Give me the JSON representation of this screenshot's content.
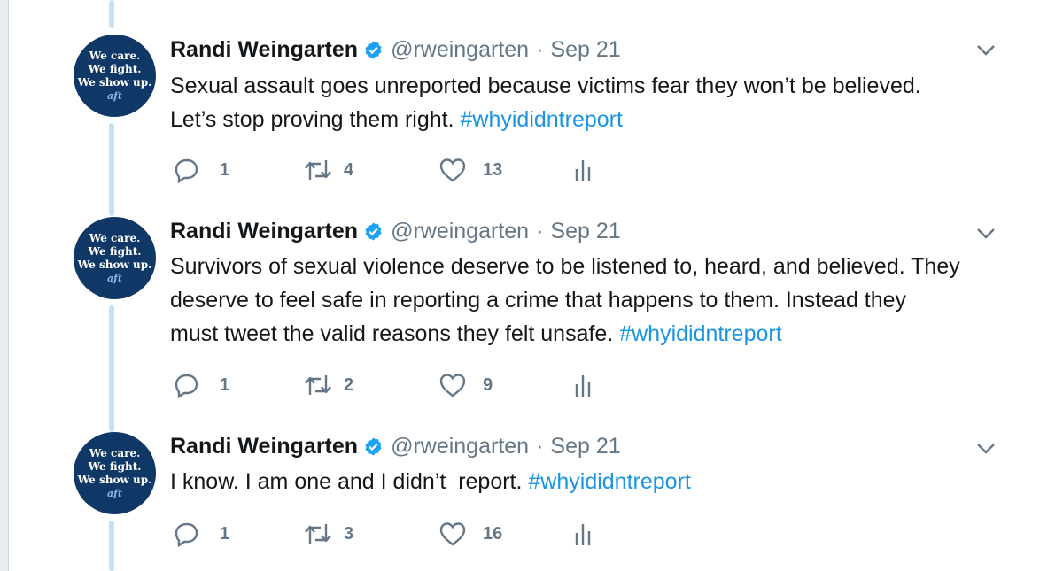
{
  "avatar": {
    "lines": [
      "We care.",
      "We fight.",
      "We show up."
    ],
    "logo": "aft"
  },
  "tweets": [
    {
      "name": "Randi Weingarten",
      "handle": "@rweingarten",
      "separator": "·",
      "date": "Sep 21",
      "text_lines": [
        "Sexual assault goes unreported because victims fear they won’t be believed.",
        "Let’s stop proving them right. "
      ],
      "hashtag": "#whyididntreport",
      "replies": "1",
      "retweets": "4",
      "likes": "13"
    },
    {
      "name": "Randi Weingarten",
      "handle": "@rweingarten",
      "separator": "·",
      "date": "Sep 21",
      "text_lines": [
        "Survivors of sexual violence deserve to be listened to, heard, and believed. They",
        "deserve to feel safe in reporting a crime that happens to them. Instead they",
        "must tweet the valid reasons they felt unsafe. "
      ],
      "hashtag": "#whyididntreport",
      "replies": "1",
      "retweets": "2",
      "likes": "9"
    },
    {
      "name": "Randi Weingarten",
      "handle": "@rweingarten",
      "separator": "·",
      "date": "Sep 21",
      "text_lines": [
        "I know. I am one and I didn’t  report. "
      ],
      "hashtag": "#whyididntreport",
      "replies": "1",
      "retweets": "3",
      "likes": "16"
    }
  ],
  "colors": {
    "text": "#14171a",
    "secondary": "#657786",
    "link": "#1b95e0",
    "verified": "#1da1f2",
    "avatar_bg": "#0f3866",
    "thread_line": "#c4e2f7"
  },
  "icons": [
    "reply-icon",
    "retweet-icon",
    "like-icon",
    "analytics-icon",
    "verified-badge-icon",
    "chevron-down-icon"
  ]
}
